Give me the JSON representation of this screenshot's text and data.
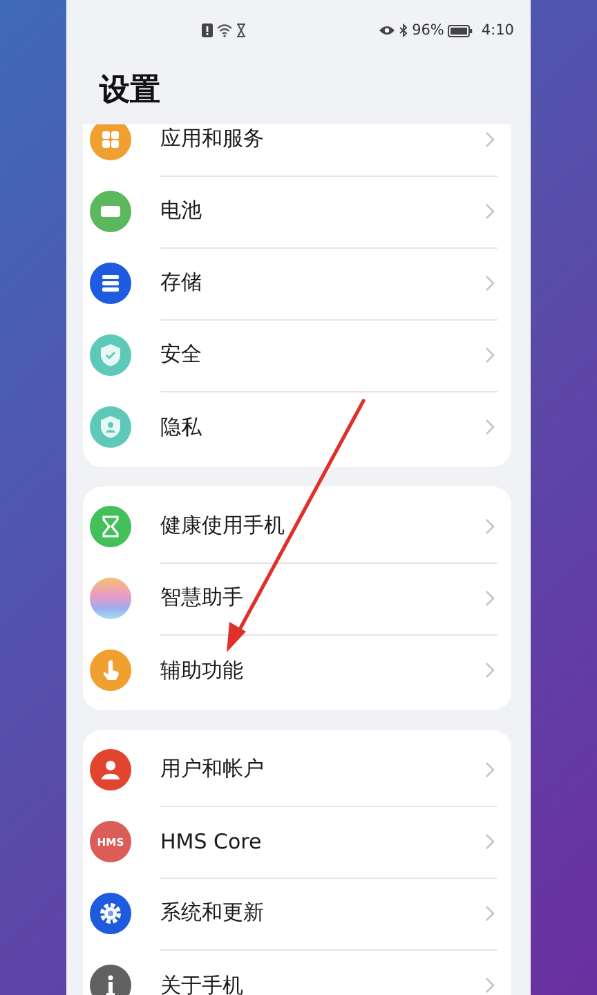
{
  "status_bar": {
    "battery": "96%",
    "time": "4:10"
  },
  "title": "设置",
  "groups": [
    {
      "items": [
        {
          "label": "应用和服务",
          "kind": "apps",
          "color": "#f0a030"
        },
        {
          "label": "电池",
          "kind": "battery",
          "color": "#5cb85c"
        },
        {
          "label": "存储",
          "kind": "storage",
          "color": "#1e5be0"
        },
        {
          "label": "安全",
          "kind": "shield",
          "color": "#5ec9b8"
        },
        {
          "label": "隐私",
          "kind": "privacy",
          "color": "#5ec9b8"
        }
      ]
    },
    {
      "items": [
        {
          "label": "健康使用手机",
          "kind": "hourglass",
          "color": "#44c05a"
        },
        {
          "label": "智慧助手",
          "kind": "assistant"
        },
        {
          "label": "辅助功能",
          "kind": "hand",
          "color": "#f0a030"
        }
      ]
    },
    {
      "items": [
        {
          "label": "用户和帐户",
          "kind": "user",
          "color": "#e2452f"
        },
        {
          "label": "HMS Core",
          "kind": "text",
          "icon_text": "HMS",
          "color": "#dc5c58"
        },
        {
          "label": "系统和更新",
          "kind": "gear",
          "color": "#1e5be0"
        },
        {
          "label": "关于手机",
          "kind": "info",
          "color": "#616161"
        }
      ]
    }
  ]
}
